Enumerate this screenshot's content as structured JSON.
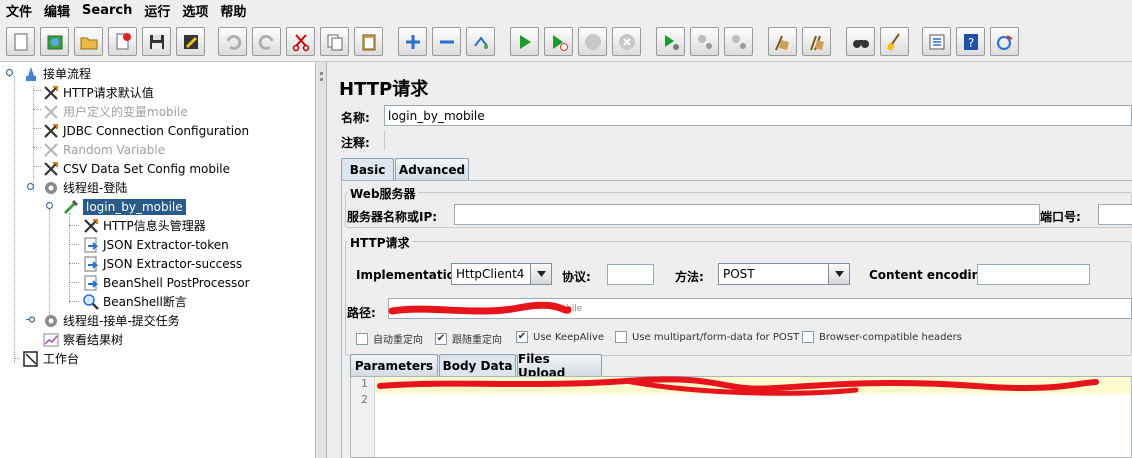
{
  "menu": [
    "文件",
    "编辑",
    "Search",
    "运行",
    "选项",
    "帮助"
  ],
  "toolbar": {
    "buttons": [
      "new-icon",
      "templates-icon",
      "open-icon",
      "close-icon",
      "save-icon",
      "save-screenshot-icon",
      "undo-icon",
      "redo-icon",
      "cut-icon",
      "copy-icon",
      "paste-icon",
      "expand-icon",
      "collapse-icon",
      "toggle-icon",
      "start-icon",
      "start-no-timers-icon",
      "stop-icon",
      "shutdown-icon",
      "remote-start-icon",
      "remote-stop-icon",
      "remote-shutdown-icon",
      "clear-icon",
      "clear-all-icon",
      "search-icon",
      "reset-search-icon",
      "function-helper-icon",
      "help-icon",
      "log-viewer-icon"
    ]
  },
  "tree": {
    "nodes": [
      {
        "label": "接单流程",
        "icon": "test-plan-icon",
        "disabled": false
      },
      {
        "label": "HTTP请求默认值",
        "icon": "config-icon",
        "disabled": false
      },
      {
        "label": "用户定义的变量mobile",
        "icon": "config-icon",
        "disabled": true
      },
      {
        "label": "JDBC Connection Configuration",
        "icon": "config-icon",
        "disabled": false
      },
      {
        "label": "Random Variable",
        "icon": "config-icon",
        "disabled": true
      },
      {
        "label": "CSV Data Set Config mobile",
        "icon": "config-icon",
        "disabled": false
      },
      {
        "label": "线程组-登陆",
        "icon": "thread-group-icon",
        "disabled": false
      },
      {
        "label": "login_by_mobile",
        "icon": "sampler-icon",
        "disabled": false,
        "selected": true
      },
      {
        "label": "HTTP信息头管理器",
        "icon": "config-icon",
        "disabled": false
      },
      {
        "label": "JSON Extractor-token",
        "icon": "post-processor-icon",
        "disabled": false
      },
      {
        "label": "JSON Extractor-success",
        "icon": "post-processor-icon",
        "disabled": false
      },
      {
        "label": "BeanShell PostProcessor",
        "icon": "post-processor-icon",
        "disabled": false
      },
      {
        "label": "BeanShell断言",
        "icon": "assertion-icon",
        "disabled": false
      },
      {
        "label": "线程组-接单-提交任务",
        "icon": "thread-group-icon",
        "disabled": false
      },
      {
        "label": "察看结果树",
        "icon": "listener-icon",
        "disabled": false
      },
      {
        "label": "工作台",
        "icon": "workbench-icon",
        "disabled": false
      }
    ]
  },
  "panel": {
    "title": "HTTP请求",
    "name_label": "名称:",
    "name_value": "login_by_mobile",
    "comment_label": "注释:",
    "comment_value": "",
    "tabs": [
      "Basic",
      "Advanced"
    ],
    "web_server": {
      "title": "Web服务器",
      "server_label": "服务器名称或IP:",
      "server_value": "",
      "port_label": "端口号:",
      "port_value": ""
    },
    "http_request": {
      "title": "HTTP请求",
      "impl_label": "Implementation:",
      "impl_value": "HttpClient4",
      "protocol_label": "协议:",
      "protocol_value": "",
      "method_label": "方法:",
      "method_value": "POST",
      "encoding_label": "Content encoding:",
      "encoding_value": "",
      "path_label": "路径:",
      "path_tail": "bile"
    },
    "checkboxes": [
      {
        "label": "自动重定向",
        "checked": false
      },
      {
        "label": "跟随重定向",
        "checked": true
      },
      {
        "label": "Use KeepAlive",
        "checked": true
      },
      {
        "label": "Use multipart/form-data for POST",
        "checked": false
      },
      {
        "label": "Browser-compatible headers",
        "checked": false
      }
    ],
    "body_tabs": [
      "Parameters",
      "Body Data",
      "Files Upload"
    ],
    "editor_lines": [
      "1",
      "2"
    ],
    "check_mark": "✔"
  },
  "colors": {
    "selection": "#2a5a89",
    "redaction": "#e8141c",
    "editor_highlight": "#fffbcf"
  }
}
